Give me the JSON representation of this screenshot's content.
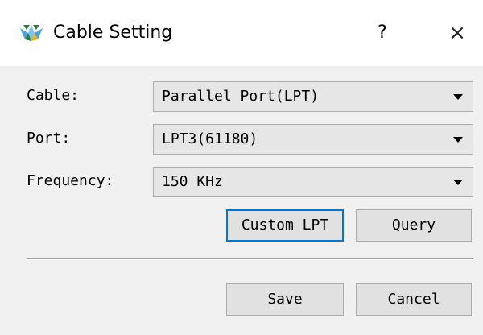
{
  "window": {
    "title": "Cable Setting",
    "help_label": "?",
    "close_label": "×",
    "icon": "gowin-logo-icon"
  },
  "form": {
    "cable": {
      "label": "Cable:",
      "value": "Parallel Port(LPT)"
    },
    "port": {
      "label": "Port:",
      "value": "LPT3(61180)"
    },
    "frequency": {
      "label": "Frequency:",
      "value": "150 KHz"
    }
  },
  "buttons": {
    "custom_lpt": "Custom LPT",
    "query": "Query",
    "save": "Save",
    "cancel": "Cancel"
  },
  "colors": {
    "focus_border": "#0078d7",
    "dialog_bg": "#f0f0f0",
    "logo_primary": "#4aa3df",
    "logo_accent": "#2e7d32"
  }
}
